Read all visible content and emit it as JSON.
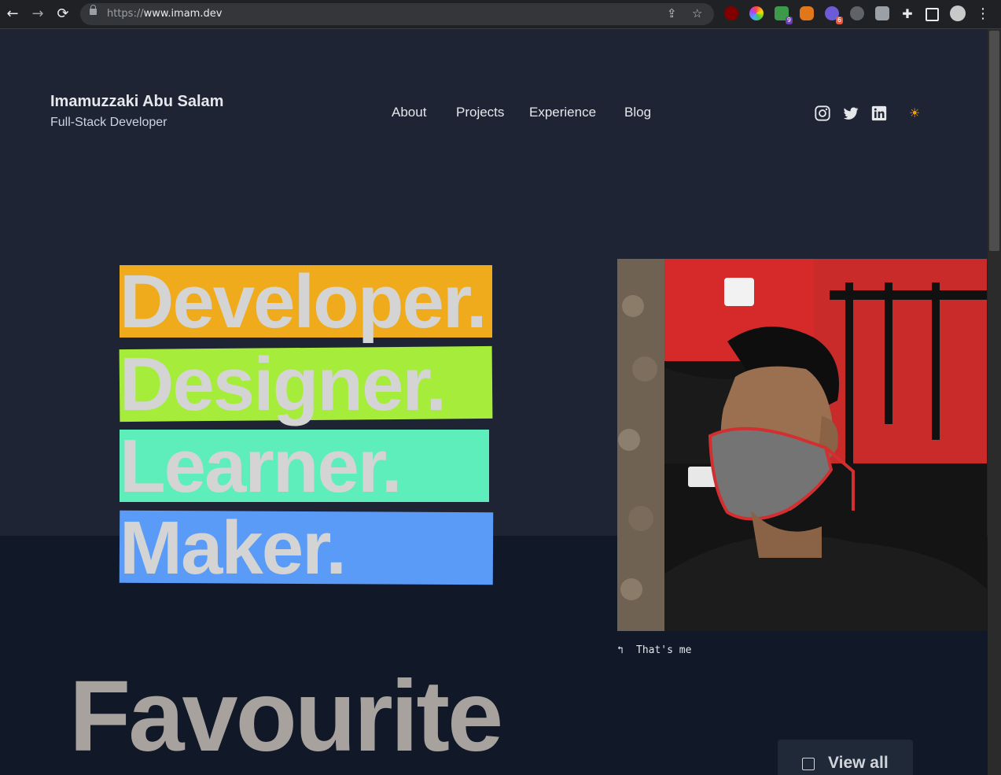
{
  "browser": {
    "url_scheme": "https://",
    "url_host": "www.imam.dev",
    "back_icon": "back-arrow-icon",
    "forward_icon": "forward-arrow-icon",
    "reload_icon": "reload-icon",
    "share_icon": "share-icon",
    "bookmark_icon": "star-icon",
    "extension_badges": [
      "9",
      "6"
    ]
  },
  "header": {
    "site_name": "Imamuzzaki Abu Salam",
    "site_role": "Full-Stack Developer",
    "nav": [
      "About",
      "Projects",
      "Experience",
      "Blog"
    ],
    "social": [
      "instagram-icon",
      "twitter-icon",
      "linkedin-icon"
    ],
    "theme_toggle": "☀"
  },
  "hero": {
    "words": [
      {
        "text": "Developer.",
        "color": "#f0ab1c"
      },
      {
        "text": "Designer.",
        "color": "#a6ec3a"
      },
      {
        "text": "Learner.",
        "color": "#5eeebb"
      },
      {
        "text": "Maker.",
        "color": "#5a9bf8"
      }
    ],
    "photo_caption": "That's me"
  },
  "section": {
    "title": "Favourite",
    "view_all": "View all"
  }
}
